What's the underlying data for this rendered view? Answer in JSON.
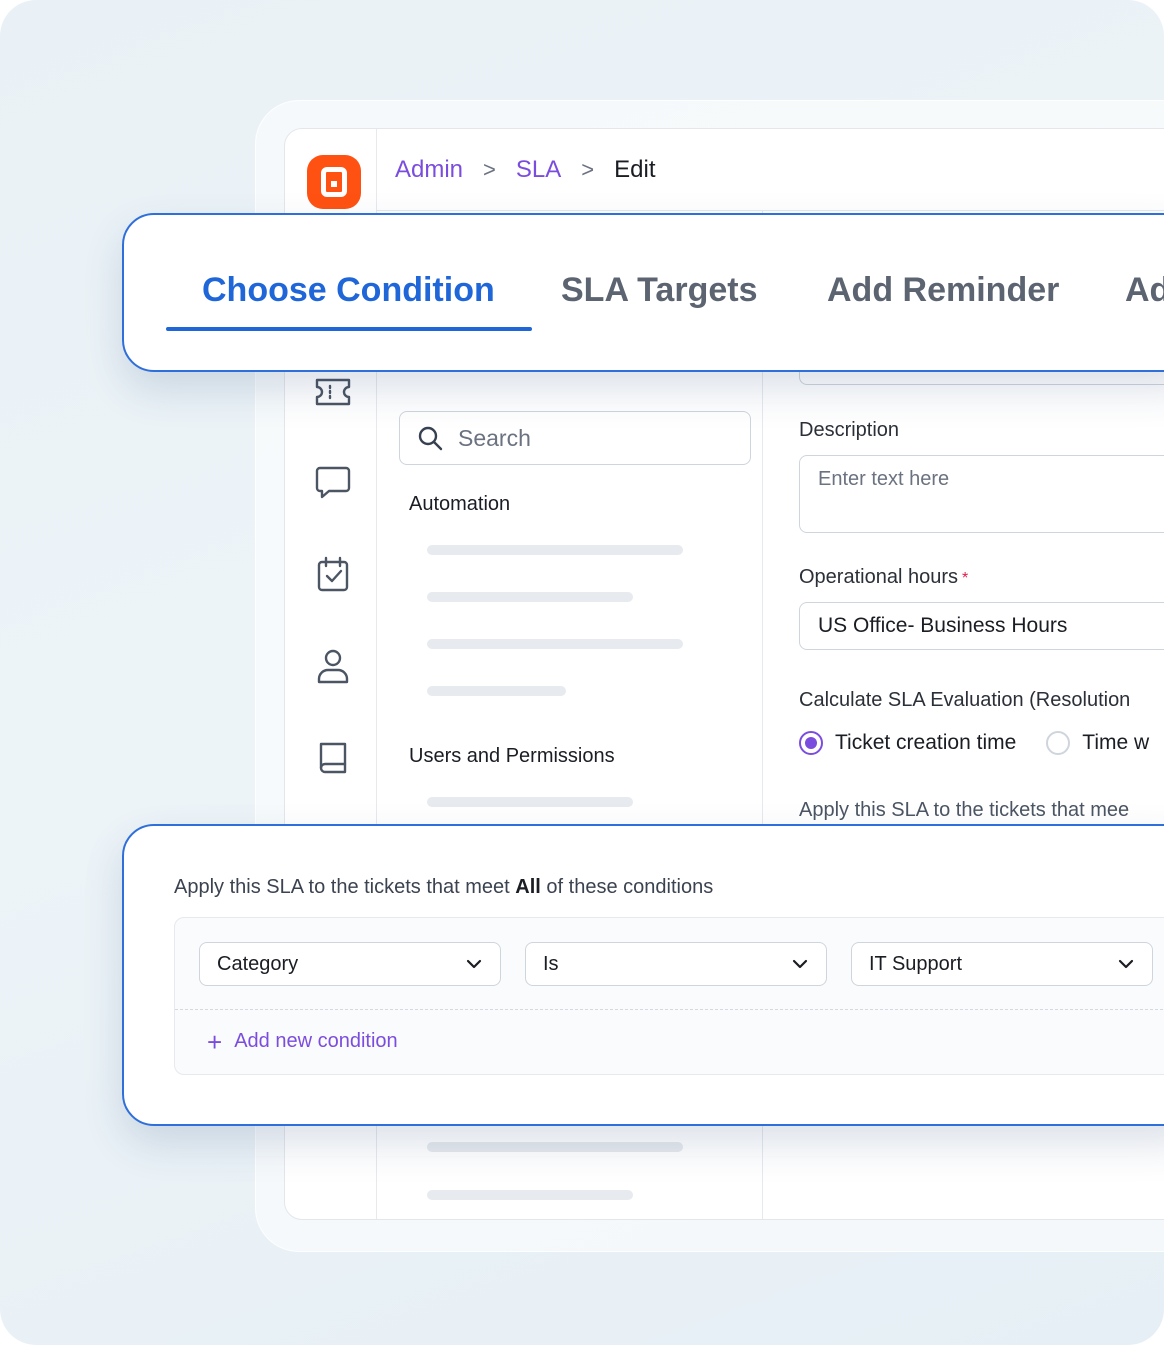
{
  "breadcrumb": {
    "items": [
      {
        "label": "Admin"
      },
      {
        "label": "SLA"
      }
    ],
    "current": "Edit",
    "separator": ">"
  },
  "tabs": [
    {
      "label": "Choose Condition",
      "active": true
    },
    {
      "label": "SLA Targets",
      "active": false
    },
    {
      "label": "Add Reminder",
      "active": false
    },
    {
      "label": "Ad",
      "active": false
    }
  ],
  "sidebar": {
    "icons": [
      "ticket-icon",
      "chat-icon",
      "calendar-check-icon",
      "user-icon",
      "book-icon"
    ]
  },
  "middle": {
    "search_placeholder": "Search",
    "sections": [
      {
        "title": "Automation"
      },
      {
        "title": "Users and Permissions"
      }
    ]
  },
  "form": {
    "description_label": "Description",
    "description_placeholder": "Enter text here",
    "operational_hours_label": "Operational hours",
    "required_marker": "*",
    "operational_hours_value": "US Office- Business Hours",
    "evaluation_label": "Calculate SLA Evaluation (Resolution",
    "radio_options": [
      {
        "label": "Ticket creation time",
        "checked": true
      },
      {
        "label": "Time w",
        "checked": false
      }
    ],
    "trailing_text": "Apply this SLA to the tickets that mee"
  },
  "conditions": {
    "heading_prefix": "Apply this SLA to the tickets that meet",
    "heading_bold": "All",
    "heading_suffix": "of these conditions",
    "row": {
      "field": "Category",
      "operator": "Is",
      "value": "IT Support"
    },
    "add_label": "Add new condition"
  },
  "colors": {
    "accent_blue": "#1f66d9",
    "accent_purple": "#7b4dde",
    "brand_orange": "#ff5212",
    "required_red": "#e11d48"
  }
}
